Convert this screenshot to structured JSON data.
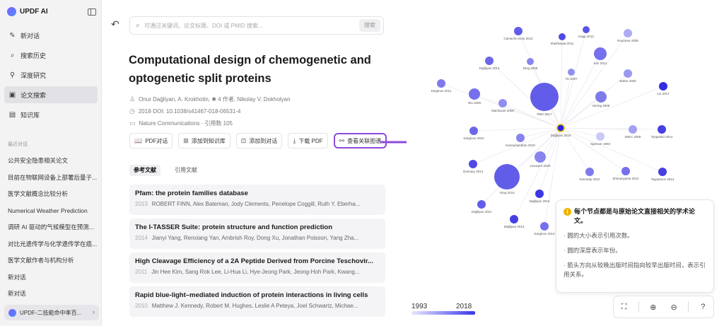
{
  "app": {
    "name": "UPDF AI"
  },
  "sidebar": {
    "items": [
      {
        "label": "新对话",
        "icon": "edit-icon",
        "glyph": "✎"
      },
      {
        "label": "搜索历史",
        "icon": "search-icon",
        "glyph": "⌕"
      },
      {
        "label": "深度研究",
        "icon": "telescope-icon",
        "glyph": "⚲"
      },
      {
        "label": "论文搜索",
        "icon": "paper-search-icon",
        "glyph": "▣",
        "active": true
      },
      {
        "label": "知识库",
        "icon": "book-icon",
        "glyph": "▤"
      }
    ],
    "recent_title": "最近对话",
    "recent": [
      "公共安全隐患相关论文",
      "目前在物联网设备上部署后量子...",
      "医学文献概念比较分析",
      "Numerical Weather Prediction",
      "调研 AI 驱动的气候模型在预测...",
      "对比光遗传学与化学遗传学在癌...",
      "医学文献作者与机构分析",
      "新对话",
      "新对话"
    ],
    "user_label": "UPDF-二技能命中率百..."
  },
  "main": {
    "search_placeholder": "可通过关键词、论文标题、DOI 或 PMID 搜索...",
    "search_button": "搜索",
    "title": "Computational design of chemogenetic and optogenetic split proteins",
    "authors": "Onur Dağliyan, A. Krokhotin, ✱ 4 作者, Nikolay V. Dokholyan",
    "doi": "2018·DOI: 10.1038/s41467-018-06531-4",
    "journal": "Nature Communications · 引用数 105",
    "actions": [
      {
        "label": "PDF对话",
        "icon": "book-open-icon",
        "glyph": "📖"
      },
      {
        "label": "添加到知识库",
        "icon": "library-icon",
        "glyph": "⊞"
      },
      {
        "label": "添加到对话",
        "icon": "chat-add-icon",
        "glyph": "⊡"
      },
      {
        "label": "下载 PDF",
        "icon": "download-icon",
        "glyph": "⤓"
      },
      {
        "label": "查看关联图谱",
        "icon": "graph-icon",
        "glyph": "⚯",
        "highlight": true
      }
    ],
    "tabs": [
      {
        "label": "参考文献",
        "active": true
      },
      {
        "label": "引用文献"
      }
    ],
    "refs": [
      {
        "title": "Pfam: the protein families database",
        "year": "2013",
        "authors": "ROBERT FINN, Alex Bateman, Jody Clements, Penelope Coggill, Ruth Y. Eberha..."
      },
      {
        "title": "The I-TASSER Suite: protein structure and function prediction",
        "year": "2014",
        "authors": "Jianyi Yang, Renxiang Yan, Ambrish Roy, Dong Xu, Jonathan Poisson, Yang Zha..."
      },
      {
        "title": "High Cleavage Efficiency of a 2A Peptide Derived from Porcine Teschovir...",
        "year": "2011",
        "authors": "Jin Hee Kim, Sang Rok Lee, Li-Hua Li, Hye-Jeong Park, Jeong-Hoh Park, Kwang..."
      },
      {
        "title": "Rapid blue-light–mediated induction of protein interactions in living cells",
        "year": "2010",
        "authors": "Matthew J. Kennedy, Robert M. Hughes, Leslie A Peteya, Joel Schwartz, Michae..."
      }
    ]
  },
  "graph": {
    "center": {
      "label": "Dağliyan 2018"
    },
    "nodes": [
      {
        "label": "Camacho-Soto 2014",
        "shade": 0.7
      },
      {
        "label": "Kapp 2012",
        "shade": 0.75
      },
      {
        "label": "Shekhawat 2011",
        "shade": 0.8
      },
      {
        "label": "Rountree 2005",
        "shade": 0.3
      },
      {
        "label": "Kim 2011",
        "shade": 0.6
      },
      {
        "label": "Dağliyan 2013",
        "shade": 0.65
      },
      {
        "label": "Ding 2009",
        "shade": 0.5
      },
      {
        "label": "Yin 2007",
        "shade": 0.45
      },
      {
        "label": "Bahar 2000",
        "shade": 0.4
      },
      {
        "label": "Karginov 2011",
        "shade": 0.55
      },
      {
        "label": "Liu 2017",
        "shade": 0.95
      },
      {
        "label": "Wu 2009",
        "shade": 0.6
      },
      {
        "label": "RMA 2017",
        "shade": 0.7
      },
      {
        "label": "Machacek 2009",
        "shade": 0.45
      },
      {
        "label": "Hering 2008",
        "shade": 0.55
      },
      {
        "label": "Karginov 2010",
        "shade": 0.65
      },
      {
        "label": "Kamachandran 2010",
        "shade": 0.5
      },
      {
        "label": "Spencer 1993",
        "shade": 0.15
      },
      {
        "label": "Weirc 2006",
        "shade": 0.35
      },
      {
        "label": "Tyspenko 2014",
        "shade": 0.85
      },
      {
        "label": "Lavorpre 2020",
        "shade": 0.5
      },
      {
        "label": "Gennary 2014",
        "shade": 0.8
      },
      {
        "label": "Kennedy 2010",
        "shade": 0.55
      },
      {
        "label": "Shimanyants 2012",
        "shade": 0.6
      },
      {
        "label": "Tsyparinov 2014",
        "shade": 0.85
      },
      {
        "label": "Yang 2014",
        "shade": 0.7
      },
      {
        "label": "Dağliyan 2016",
        "shade": 0.9
      },
      {
        "label": "Dağliyan 2011",
        "shade": 0.7
      },
      {
        "label": "Dağliyan 2013",
        "shade": 0.85
      },
      {
        "label": "Karginov 2014",
        "shade": 0.6
      }
    ],
    "legend": {
      "min": "1993",
      "max": "2018"
    },
    "colors": {
      "low": "#e6e6fb",
      "high": "#2a22e0",
      "center_ring": "#e2c400"
    },
    "info": {
      "title": "每个节点都是与原始论文直接相关的学术论文。",
      "lines": [
        "· 圆的大小表示引用次数。",
        "· 圆的深度表示年份。",
        "· 箭头方向从较晚出版时间指向较早出版时间，表示引用关系。"
      ]
    },
    "toolbar": [
      {
        "name": "fit-view-button",
        "icon": "fit-icon",
        "glyph": "⛶"
      },
      {
        "name": "zoom-in-button",
        "icon": "zoom-in-icon",
        "glyph": "⊕"
      },
      {
        "name": "zoom-out-button",
        "icon": "zoom-out-icon",
        "glyph": "⊖"
      },
      {
        "name": "help-button",
        "icon": "help-icon",
        "glyph": "?"
      }
    ]
  }
}
